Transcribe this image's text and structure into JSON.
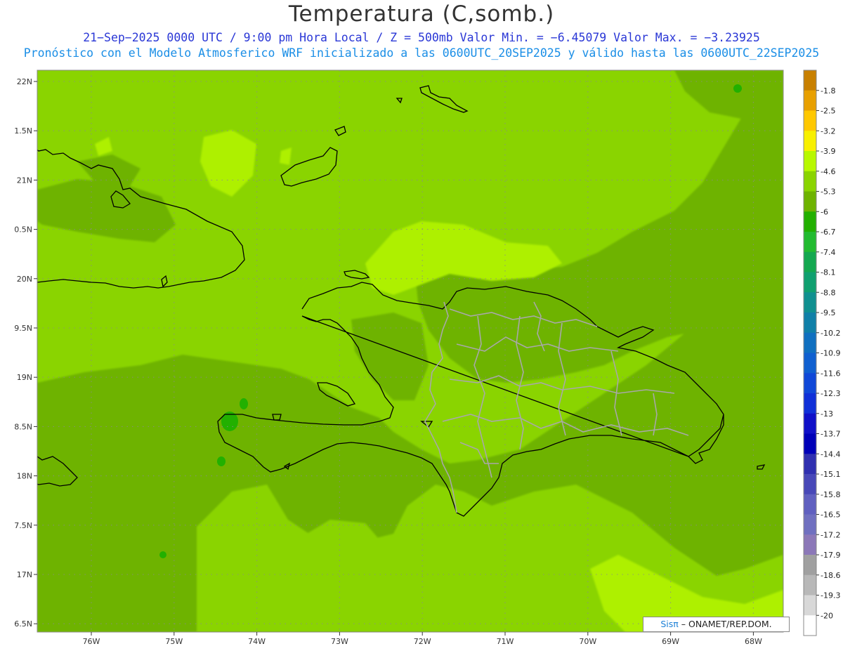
{
  "header": {
    "title": "Temperatura (C,somb.)",
    "subtitle_1": "21−Sep−2025  0000 UTC / 9:00 pm Hora Local / Z = 500mb  Valor Min. = −6.45079  Valor Max. = −3.23925",
    "subtitle_2": "Pronóstico con el Modelo Atmosferico WRF inicializado a las 0600UTC_20SEP2025 y válido hasta las  0600UTC_22SEP2025"
  },
  "map": {
    "lat_ticks": [
      "22N",
      "1.5N",
      "21N",
      "0.5N",
      "20N",
      "9.5N",
      "19N",
      "8.5N",
      "18N",
      "7.5N",
      "17N",
      "6.5N"
    ],
    "lon_ticks": [
      "76W",
      "75W",
      "74W",
      "73W",
      "72W",
      "71W",
      "70W",
      "69W",
      "68W"
    ],
    "field_colors": {
      "dark_green": "#6eb300",
      "mid_green": "#8ad400",
      "light_green": "#aef000",
      "deep_green": "#22b000"
    },
    "coast_color": "#000000",
    "border_color": "#a8a8a8"
  },
  "colorbar": {
    "labels": [
      "-1.8",
      "-2.5",
      "-3.2",
      "-3.9",
      "-4.6",
      "-5.3",
      "-6",
      "-6.7",
      "-7.4",
      "-8.1",
      "-8.8",
      "-9.5",
      "-10.2",
      "-10.9",
      "-11.6",
      "-12.3",
      "-13",
      "-13.7",
      "-14.4",
      "-15.1",
      "-15.8",
      "-16.5",
      "-17.2",
      "-17.9",
      "-18.6",
      "-19.3",
      "-20"
    ],
    "colors": [
      "#c88000",
      "#e8a000",
      "#ffc800",
      "#f8f000",
      "#b8f800",
      "#8ad400",
      "#6eb300",
      "#22b000",
      "#22bb30",
      "#14a850",
      "#10a070",
      "#109090",
      "#1080a8",
      "#1070c0",
      "#1060d0",
      "#1048d8",
      "#1030d8",
      "#1010c8",
      "#0000b8",
      "#3030b0",
      "#4848b8",
      "#6060c0",
      "#7070c0",
      "#8c78b8",
      "#a0a0a0",
      "#b8b8b8",
      "#d8d8d8",
      "#ffffff"
    ]
  },
  "credit": {
    "sis": "Sisπ",
    "rest": " – ONAMET/REP.DOM."
  }
}
